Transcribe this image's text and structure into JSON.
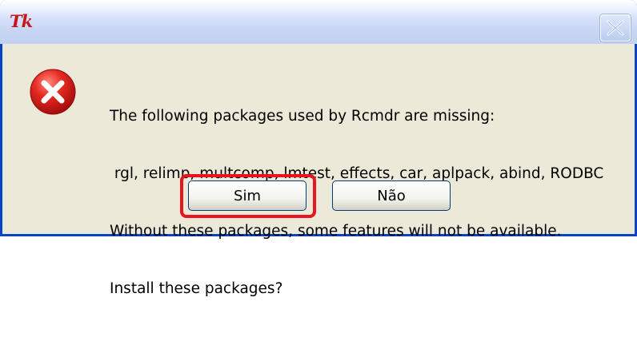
{
  "window": {
    "logo_text": "Tk"
  },
  "dialog": {
    "message_lines": [
      "The following packages used by Rcmdr are missing:",
      " rgl, relimp, multcomp, lmtest, effects, car, aplpack, abind, RODBC",
      "Without these packages, some features will not be available.",
      "Install these packages?"
    ],
    "icon": "error-icon",
    "buttons": {
      "yes_label": "Sim",
      "no_label": "Não"
    }
  },
  "annotation": {
    "highlight_color": "#e8141e",
    "highlighted": "yes-button"
  },
  "colors": {
    "dialog_background": "#ece9d8",
    "window_border": "#0a44c6",
    "error_red": "#d81e1e"
  }
}
